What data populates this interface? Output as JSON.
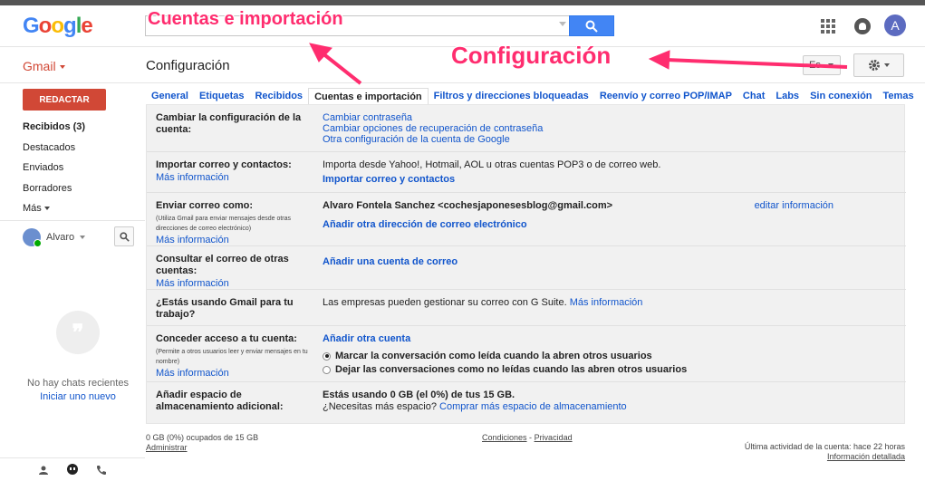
{
  "header": {
    "logo": [
      {
        "ch": "G",
        "color": "#4285f4"
      },
      {
        "ch": "o",
        "color": "#ea4335"
      },
      {
        "ch": "o",
        "color": "#fbbc05"
      },
      {
        "ch": "g",
        "color": "#4285f4"
      },
      {
        "ch": "l",
        "color": "#34a853"
      },
      {
        "ch": "e",
        "color": "#ea4335"
      }
    ],
    "avatar_initial": "A"
  },
  "subheader": {
    "gmail_label": "Gmail",
    "page_title": "Configuración",
    "lang_button": "Es"
  },
  "sidebar": {
    "compose": "REDACTAR",
    "items": [
      {
        "label": "Recibidos (3)",
        "bold": true
      },
      {
        "label": "Destacados"
      },
      {
        "label": "Enviados"
      },
      {
        "label": "Borradores"
      },
      {
        "label": "Más"
      }
    ],
    "chat_user": "Alvaro",
    "no_chats": "No hay chats recientes",
    "start_new": "Iniciar uno nuevo"
  },
  "tabs": [
    {
      "label": "General"
    },
    {
      "label": "Etiquetas"
    },
    {
      "label": "Recibidos"
    },
    {
      "label": "Cuentas e importación",
      "active": true
    },
    {
      "label": "Filtros y direcciones bloqueadas"
    },
    {
      "label": "Reenvío y correo POP/IMAP"
    },
    {
      "label": "Chat"
    },
    {
      "label": "Labs"
    },
    {
      "label": "Sin conexión"
    },
    {
      "label": "Temas"
    }
  ],
  "settings": {
    "change_account": {
      "label": "Cambiar la configuración de la cuenta:",
      "links": [
        "Cambiar contraseña",
        "Cambiar opciones de recuperación de contraseña",
        "Otra configuración de la cuenta de Google"
      ]
    },
    "import": {
      "label": "Importar correo y contactos:",
      "more": "Más información",
      "text": "Importa desde Yahoo!, Hotmail, AOL u otras cuentas POP3 o de correo web.",
      "link": "Importar correo y contactos"
    },
    "send_as": {
      "label": "Enviar correo como:",
      "note": "(Utiliza Gmail para enviar mensajes desde otras direcciones de correo electrónico)",
      "more": "Más información",
      "address": "Alvaro Fontela Sanchez <cochesjaponesesblog@gmail.com>",
      "edit": "editar información",
      "link": "Añadir otra dirección de correo electrónico"
    },
    "check_mail": {
      "label": "Consultar el correo de otras cuentas:",
      "more": "Más información",
      "link": "Añadir una cuenta de correo"
    },
    "gsuite": {
      "label": "¿Estás usando Gmail para tu trabajo?",
      "text": "Las empresas pueden gestionar su correo con G Suite.",
      "link": "Más información"
    },
    "grant": {
      "label": "Conceder acceso a tu cuenta:",
      "note": "(Permite a otros usuarios leer y enviar mensajes en tu nombre)",
      "more": "Más información",
      "link": "Añadir otra cuenta",
      "option1": "Marcar la conversación como leída cuando la abren otros usuarios",
      "option2": "Dejar las conversaciones como no leídas cuando las abren otros usuarios"
    },
    "storage": {
      "label": "Añadir espacio de almacenamiento adicional:",
      "text": "Estás usando 0 GB (el 0%) de tus 15 GB.",
      "question": "¿Necesitas más espacio?",
      "link": "Comprar más espacio de almacenamiento"
    }
  },
  "footer": {
    "usage": "0 GB (0%) ocupados de 15 GB",
    "manage": "Administrar",
    "terms": "Condiciones",
    "dash": "-",
    "privacy": "Privacidad",
    "activity": "Última actividad de la cuenta: hace 22 horas",
    "details": "Información detallada"
  },
  "annotations": {
    "accounts": "Cuentas e importación",
    "settings": "Configuración",
    "color": "#ff2d6f"
  }
}
